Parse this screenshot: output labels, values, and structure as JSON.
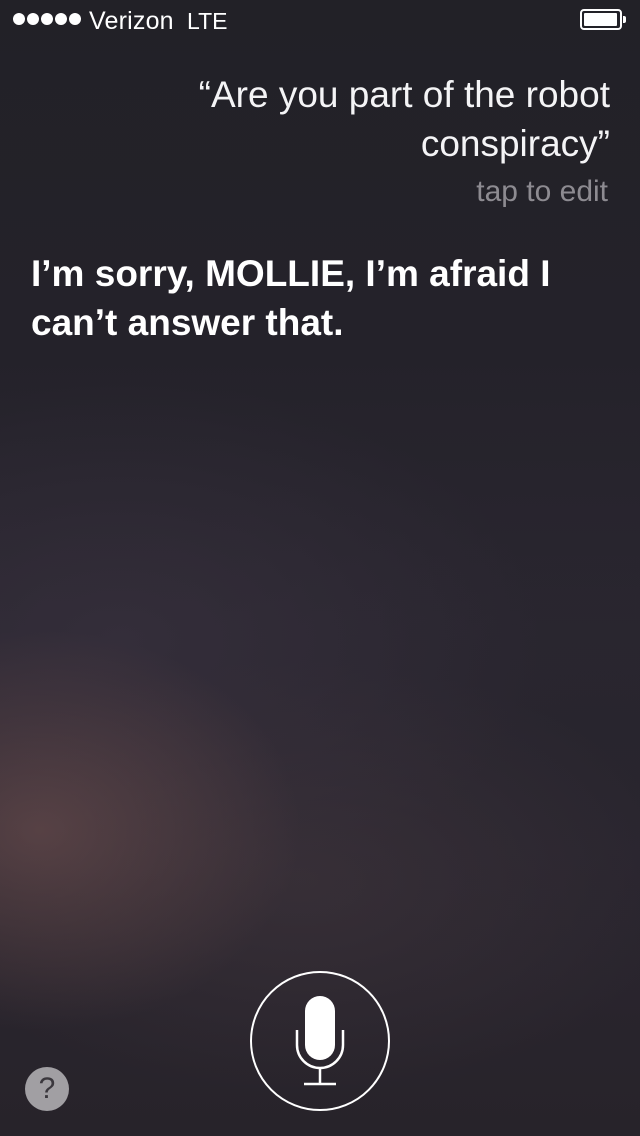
{
  "status_bar": {
    "signal_dots": 5,
    "carrier": "Verizon",
    "network": "LTE",
    "battery_icon": "battery-icon"
  },
  "conversation": {
    "query_lines": [
      "“Are you part of the robot",
      "conspiracy”"
    ],
    "tap_to_edit": "tap to edit",
    "response_lines": [
      "I’m sorry, MOLLIE, I’m afraid I",
      "can’t answer that."
    ]
  },
  "controls": {
    "mic_icon": "microphone-icon",
    "help_label": "?"
  },
  "colors": {
    "text_primary": "#ffffff",
    "text_secondary": "#8d8b91",
    "help_button_bg": "#a19fa3"
  }
}
